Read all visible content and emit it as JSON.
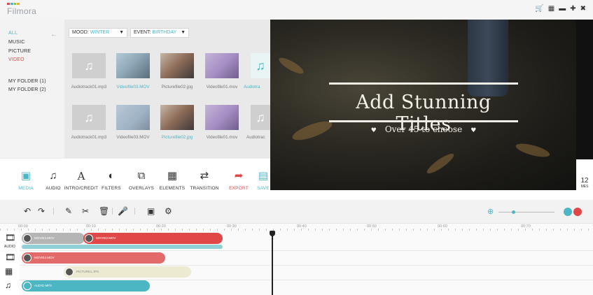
{
  "app": {
    "name": "Filmora",
    "logo_colors": [
      "#e04848",
      "#4db6c4",
      "#8bc34a",
      "#f2b134"
    ],
    "window_controls": [
      "cart-icon",
      "grid-icon",
      "minimize-icon",
      "maximize-icon",
      "close-icon"
    ]
  },
  "categories": {
    "items": [
      {
        "label": "ALL",
        "state": "selected"
      },
      {
        "label": "MUSIC"
      },
      {
        "label": "PICTURE"
      },
      {
        "label": "VIDEO",
        "state": "highlight"
      }
    ],
    "folders": [
      {
        "label": "MY FOLDER (1)"
      },
      {
        "label": "MY FOLDER (2)"
      }
    ]
  },
  "filters": {
    "mood_label": "MOOD:",
    "mood_value": "WINTER",
    "event_label": "EVENT:",
    "event_value": "BIRTHDAY"
  },
  "media": {
    "items": [
      {
        "name": "Audiotrack01.mp3",
        "kind": "audio"
      },
      {
        "name": "Videofile03.MOV",
        "kind": "photo1",
        "selected": true
      },
      {
        "name": "Picturefile02.jpg",
        "kind": "photo2"
      },
      {
        "name": "Videofile01.mov",
        "kind": "photo3"
      },
      {
        "name": "Audiotra",
        "kind": "audio",
        "selected": true
      },
      {
        "name": "Audiotrack01.mp3",
        "kind": "audio"
      },
      {
        "name": "Videofile03.MOV",
        "kind": "photo4"
      },
      {
        "name": "Picturefile02.jpg",
        "kind": "photo2",
        "selected": true
      },
      {
        "name": "Videofile01.mov",
        "kind": "photo3"
      },
      {
        "name": "Audiotrac",
        "kind": "audio"
      }
    ]
  },
  "toolbar": {
    "tools": [
      {
        "label": "MEDIA",
        "icon": "media-icon",
        "state": "active"
      },
      {
        "label": "AUDIO",
        "icon": "music-icon"
      },
      {
        "label": "INTRO/CREDIT",
        "icon": "text-icon"
      },
      {
        "label": "FILTERS",
        "icon": "filter-icon"
      },
      {
        "label": "OVERLAYS",
        "icon": "overlay-icon"
      },
      {
        "label": "ELEMENTS",
        "icon": "image-icon"
      },
      {
        "label": "TRANSITION",
        "icon": "transition-icon"
      },
      {
        "label": "EXPORT",
        "icon": "export-icon",
        "state": "export"
      },
      {
        "label": "SAVE",
        "icon": "save-icon",
        "state": "save"
      }
    ]
  },
  "preview": {
    "title": "Add Stunning Titles",
    "subtitle": "Over 45 to choose",
    "side_number": "12",
    "side_text": "MES"
  },
  "timeline": {
    "tools": [
      "undo-icon",
      "redo-icon",
      "pencil-icon",
      "split-icon",
      "delete-icon",
      "mic-icon",
      "crop-icon",
      "settings-icon"
    ],
    "ruler_ticks": [
      "00:00",
      "00:10",
      "00:20",
      "00:30",
      "00:40",
      "00:50",
      "00:60",
      "00:70"
    ],
    "track_label_audio": "AUDIO",
    "clips": [
      {
        "name": "MOVIE2.MOV",
        "color": "#b5b5b5"
      },
      {
        "name": "MOVIE2.MOV",
        "color": "#e04848"
      },
      {
        "name": "MOVIE4.MOV",
        "color": "#e26a6a"
      },
      {
        "name": "PICTURE1.JPG",
        "color": "#ecebd2"
      },
      {
        "name": "AUDIO MP3",
        "color": "#4db6c4"
      }
    ],
    "status_buttons": [
      {
        "color": "#4db6c4"
      },
      {
        "color": "#e04848"
      }
    ]
  }
}
